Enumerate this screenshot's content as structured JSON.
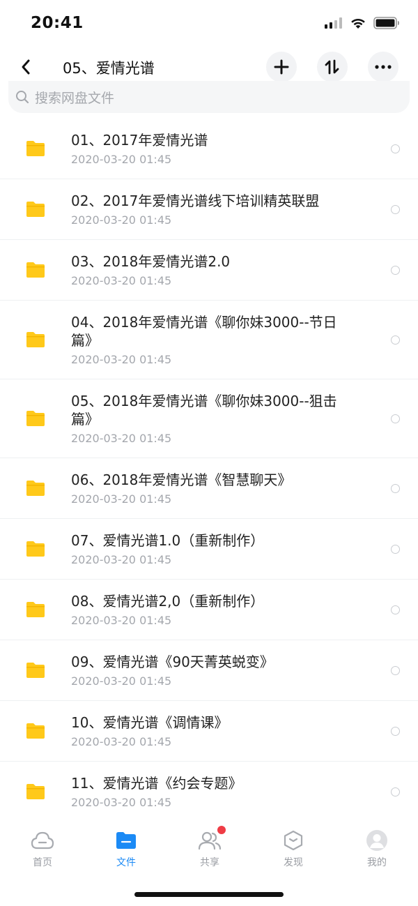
{
  "status_bar": {
    "time": "20:41"
  },
  "nav": {
    "title": "05、爱情光谱"
  },
  "search": {
    "placeholder": "搜索网盘文件"
  },
  "files": [
    {
      "name": "01、2017年爱情光谱",
      "date": "2020-03-20 01:45"
    },
    {
      "name": "02、2017年爱情光谱线下培训精英联盟",
      "date": "2020-03-20 01:45"
    },
    {
      "name": "03、2018年爱情光谱2.0",
      "date": "2020-03-20 01:45"
    },
    {
      "name": "04、2018年爱情光谱《聊你妹3000--节日篇》",
      "date": "2020-03-20 01:45"
    },
    {
      "name": "05、2018年爱情光谱《聊你妹3000--狙击篇》",
      "date": "2020-03-20 01:45"
    },
    {
      "name": "06、2018年爱情光谱《智慧聊天》",
      "date": "2020-03-20 01:45"
    },
    {
      "name": "07、爱情光谱1.0（重新制作）",
      "date": "2020-03-20 01:45"
    },
    {
      "name": "08、爱情光谱2,0（重新制作）",
      "date": "2020-03-20 01:45"
    },
    {
      "name": "09、爱情光谱《90天菁英蜕变》",
      "date": "2020-03-20 01:45"
    },
    {
      "name": "10、爱情光谱《调情课》",
      "date": "2020-03-20 01:45"
    },
    {
      "name": "11、爱情光谱《约会专题》",
      "date": "2020-03-20 01:45"
    }
  ],
  "tabs": [
    {
      "label": "首页",
      "icon": "cloud-icon"
    },
    {
      "label": "文件",
      "icon": "folder-icon"
    },
    {
      "label": "共享",
      "icon": "people-icon"
    },
    {
      "label": "发现",
      "icon": "cube-icon"
    },
    {
      "label": "我的",
      "icon": "avatar-icon"
    }
  ],
  "colors": {
    "accent": "#1b8af5",
    "folder": "#ffc91a",
    "badge": "#ef3c45"
  }
}
